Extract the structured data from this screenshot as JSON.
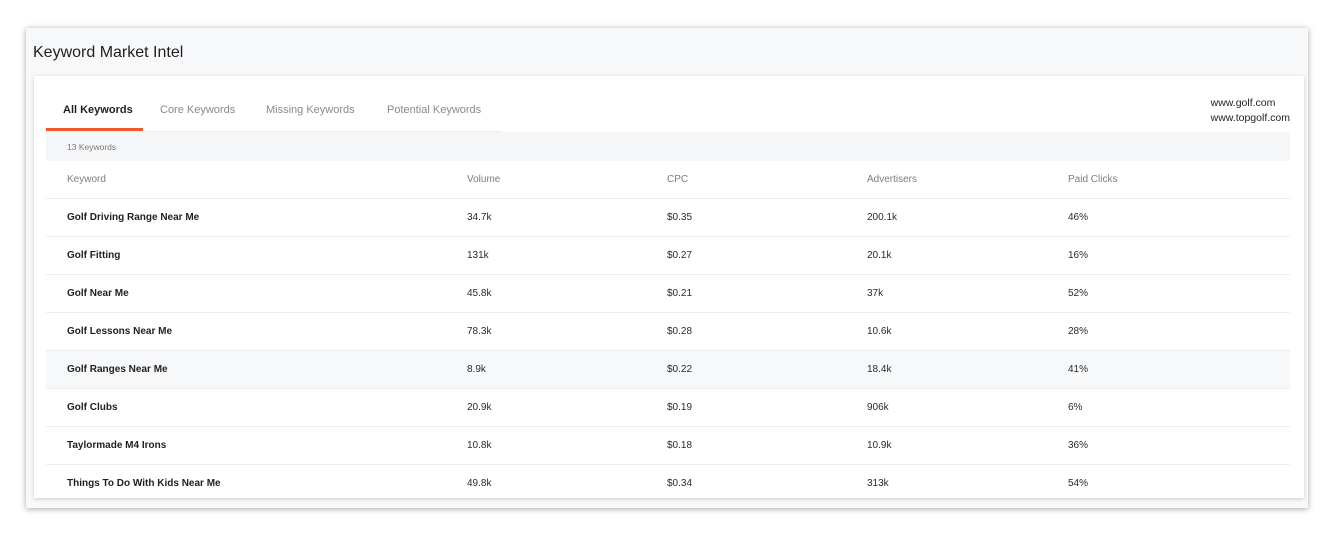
{
  "page": {
    "title": "Keyword Market Intel"
  },
  "tabs": [
    {
      "label": "All Keywords",
      "active": true
    },
    {
      "label": "Core Keywords",
      "active": false
    },
    {
      "label": "Missing Keywords",
      "active": false
    },
    {
      "label": "Potential Keywords",
      "active": false
    }
  ],
  "domains": [
    "www.golf.com",
    "www.topgolf.com"
  ],
  "accent_color": "#f05a28",
  "keyword_count": "13 Keywords",
  "table": {
    "columns": [
      "Keyword",
      "Volume",
      "CPC",
      "Advertisers",
      "Paid Clicks"
    ],
    "rows": [
      {
        "keyword": "Golf Driving Range Near Me",
        "volume": "34.7k",
        "cpc": "$0.35",
        "advertisers": "200.1k",
        "paid_clicks": "46%"
      },
      {
        "keyword": "Golf Fitting",
        "volume": "131k",
        "cpc": "$0.27",
        "advertisers": "20.1k",
        "paid_clicks": "16%"
      },
      {
        "keyword": "Golf Near Me",
        "volume": "45.8k",
        "cpc": "$0.21",
        "advertisers": "37k",
        "paid_clicks": "52%"
      },
      {
        "keyword": "Golf Lessons Near Me",
        "volume": "78.3k",
        "cpc": "$0.28",
        "advertisers": "10.6k",
        "paid_clicks": "28%"
      },
      {
        "keyword": "Golf Ranges Near Me",
        "volume": "8.9k",
        "cpc": "$0.22",
        "advertisers": "18.4k",
        "paid_clicks": "41%"
      },
      {
        "keyword": "Golf Clubs",
        "volume": "20.9k",
        "cpc": "$0.19",
        "advertisers": "906k",
        "paid_clicks": "6%"
      },
      {
        "keyword": "Taylormade M4 Irons",
        "volume": "10.8k",
        "cpc": "$0.18",
        "advertisers": "10.9k",
        "paid_clicks": "36%"
      },
      {
        "keyword": "Things To Do With Kids Near Me",
        "volume": "49.8k",
        "cpc": "$0.34",
        "advertisers": "313k",
        "paid_clicks": "54%"
      }
    ]
  }
}
